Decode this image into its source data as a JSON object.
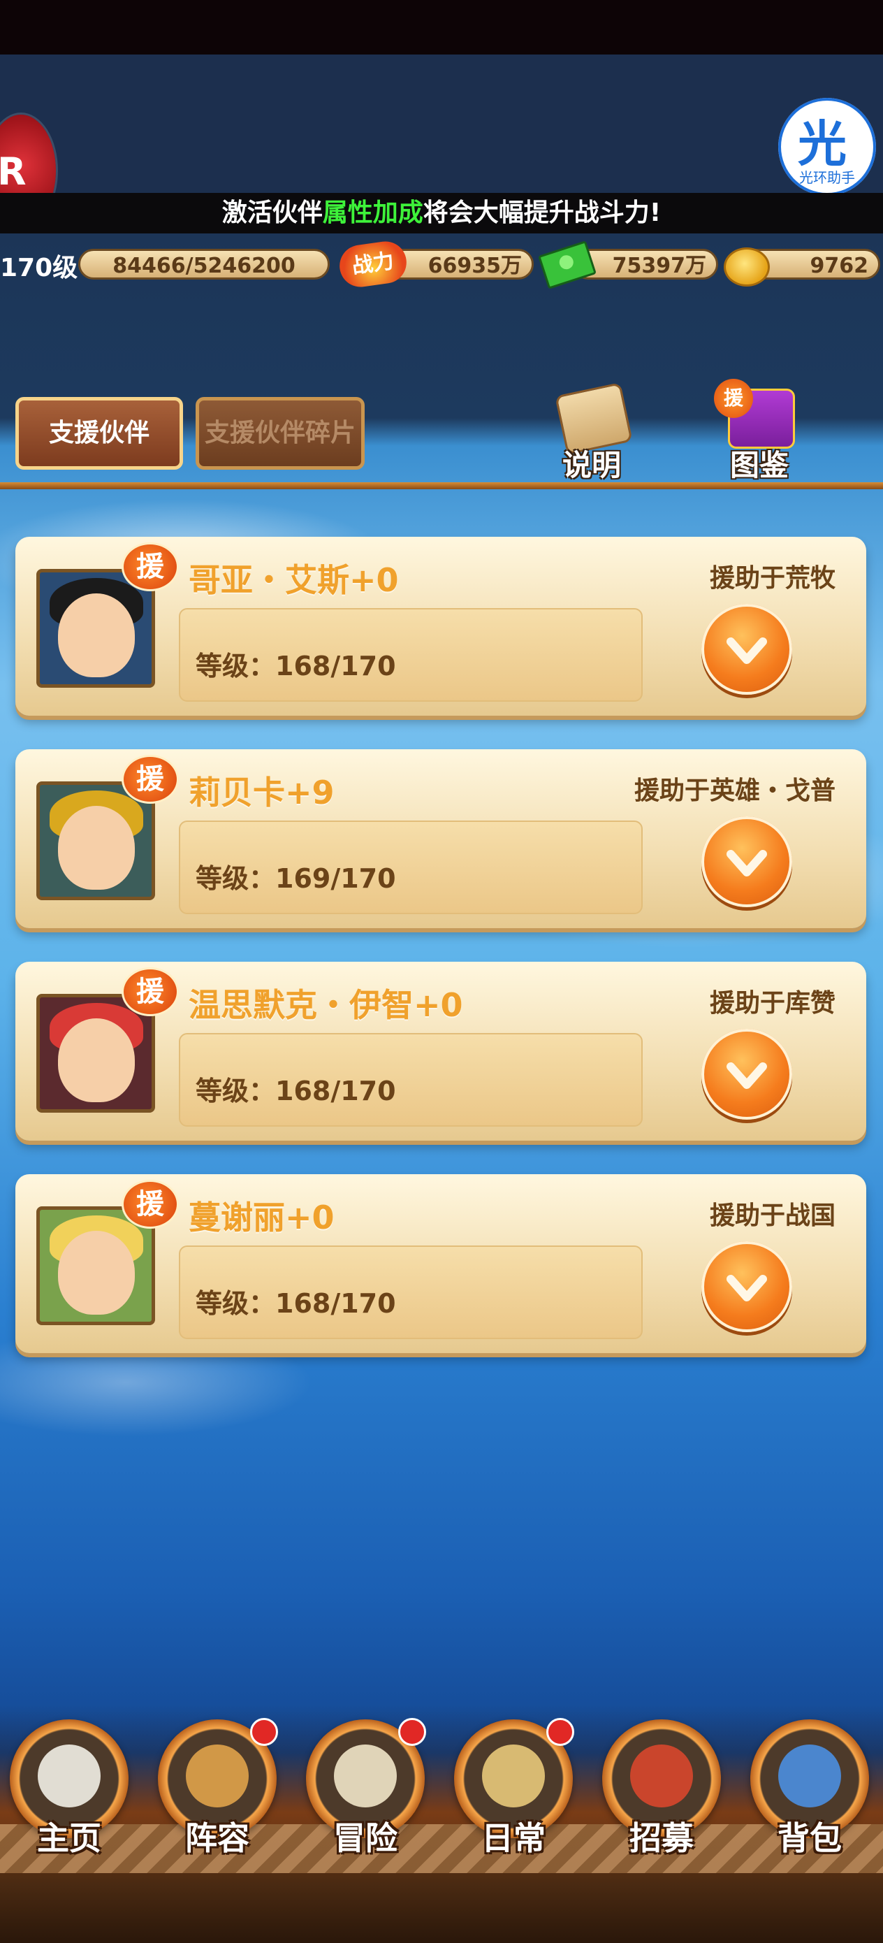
{
  "banner": {
    "pre": "激活伙伴",
    "highlight": "属性加成",
    "post": "将会大幅提升战斗力!"
  },
  "helper": {
    "glyph": "光",
    "caption": "光环助手"
  },
  "stats": {
    "level": "170级",
    "exp": "84466/5246200",
    "power_label": "战力",
    "power": "66935万",
    "cash": "75397万",
    "gold": "9762"
  },
  "tabs": {
    "active": "支援伙伴",
    "inactive": "支援伙伴碎片"
  },
  "top_icons": {
    "help_label": "说明",
    "book_label": "图鉴",
    "book_badge": "援"
  },
  "cards": [
    {
      "badge": "援",
      "name": "哥亚・艾斯+0",
      "assist": "援助于荒牧",
      "level_label": "等级：168/170",
      "portrait_color": "#2a4b73",
      "hair_color": "#1b1b1b"
    },
    {
      "badge": "援",
      "name": "莉贝卡+9",
      "assist": "援助于英雄・戈普",
      "level_label": "等级：169/170",
      "portrait_color": "#3c5d5a",
      "hair_color": "#d9a81e"
    },
    {
      "badge": "援",
      "name": "温思默克・伊智+0",
      "assist": "援助于库赞",
      "level_label": "等级：168/170",
      "portrait_color": "#5b2a2e",
      "hair_color": "#d93a36"
    },
    {
      "badge": "援",
      "name": "蔓谢丽+0",
      "assist": "援助于战国",
      "level_label": "等级：168/170",
      "portrait_color": "#7aa24c",
      "hair_color": "#f1d15a"
    }
  ],
  "nav": [
    {
      "label": "主页",
      "dot": false,
      "icon": "home-icon",
      "color": "#f2efe6"
    },
    {
      "label": "阵容",
      "dot": true,
      "icon": "lineup-icon",
      "color": "#e0a34a"
    },
    {
      "label": "冒险",
      "dot": true,
      "icon": "adventure-icon",
      "color": "#f1e5c8"
    },
    {
      "label": "日常",
      "dot": true,
      "icon": "daily-icon",
      "color": "#e8c97a"
    },
    {
      "label": "招募",
      "dot": false,
      "icon": "recruit-icon",
      "color": "#d8472c"
    },
    {
      "label": "背包",
      "dot": false,
      "icon": "bag-icon",
      "color": "#4b8fe0"
    }
  ]
}
